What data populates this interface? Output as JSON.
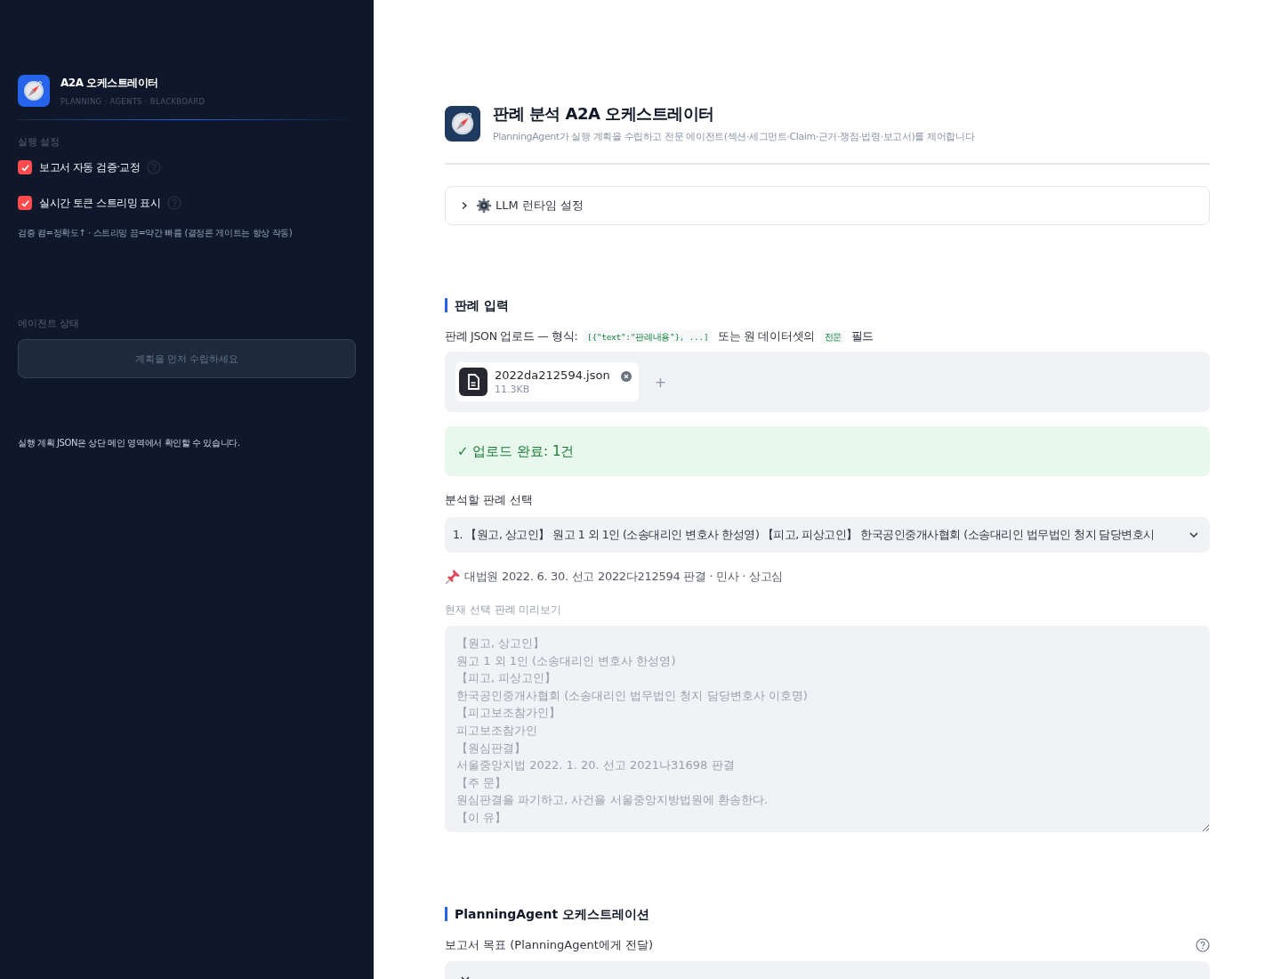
{
  "sidebar": {
    "brand": {
      "title": "A2A 오케스트레이터",
      "subtitle": "PLANNING · AGENTS · BLACKBOARD"
    },
    "settings_label": "실행 설정",
    "options": [
      {
        "label": "보고서 자동 검증·교정",
        "checked": true
      },
      {
        "label": "실시간 토큰 스트리밍 표시",
        "checked": true
      }
    ],
    "settings_note": "검증 켬=정확도↑ · 스트리밍 끔=약간 빠름 (결정론 게이트는 항상 작동)",
    "status_label": "에이전트 상태",
    "status_placeholder": "계획을 먼저 수립하세요",
    "footer_note": "실행 계획 JSON은 상단 메인 영역에서 확인할 수 있습니다."
  },
  "header": {
    "title": "판례 분석 A2A 오케스트레이터",
    "subtitle": "PlanningAgent가 실행 계획을 수립하고 전문 에이전트(섹션·세그먼트·Claim·근거·쟁점·법령·보고서)를 제어합니다"
  },
  "expander": {
    "label": "LLM 런타임 설정",
    "expanded": false
  },
  "input_section": {
    "heading": "판례 입력",
    "upload_label": [
      "판례 JSON 업로드 — 형식: ",
      "[{\"text\":\"판례내용\"}, ...]",
      " 또는 원 데이터셋의 ",
      "전문",
      " 필드"
    ],
    "file": {
      "name": "2022da212594.json",
      "size": "11.3KB"
    },
    "add_symbol": "+",
    "success": "✓ 업로드 완료: 1건",
    "select_label": "분석할 판례 선택",
    "select_value": "1. 【원고, 상고인】 원고 1 외 1인 (소송대리인 변호사 한성영) 【피고, 피상고인】 한국공인중개사협회 (소송대리인 법무법인 청지 담당변호시",
    "case_info": "대법원 2022. 6. 30. 선고 2022다212594 판결 · 민사 · 상고심",
    "preview_label": "현재 선택 판례 미리보기",
    "preview_lines": [
      "【원고, 상고인】",
      "원고 1 외 1인 (소송대리인 변호사 한성영)",
      "【피고, 피상고인】",
      "한국공인중개사협회 (소송대리인 법무법인 청지 담당변호사 이호명)",
      "【피고보조참가인】",
      "피고보조참가인",
      "【원심판결】",
      "서울중앙지법 2022. 1. 20. 선고 2021나31698 판결",
      "【주 문】",
      "원심판결을 파기하고, 사건을 서울중앙지방법원에 환송한다.",
      "【이 유】"
    ]
  },
  "planning_section": {
    "heading": "PlanningAgent 오케스트레이션",
    "goal_label": "보고서 목표 (PlanningAgent에게 전달)"
  }
}
